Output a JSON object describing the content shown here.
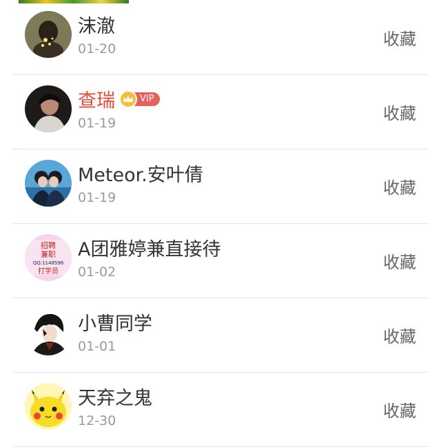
{
  "favorite_label": "收藏",
  "rows": [
    {
      "name": "沫澈",
      "date": "01-20",
      "avatar": "avatar-girl-sparkle"
    },
    {
      "name": "查瑞",
      "date": "01-19",
      "avatar": "avatar-man-portrait",
      "vip": "VIP"
    },
    {
      "name": "Meteor.安叶倩",
      "date": "01-19",
      "avatar": "avatar-couple"
    },
    {
      "name": "A团雅婷兼直接待",
      "date": "01-02",
      "avatar": "avatar-recruit-banner"
    },
    {
      "name": "小曹同学",
      "date": "01-01",
      "avatar": "avatar-anime-boy"
    },
    {
      "name": "天弃之鬼",
      "date": "12-30",
      "avatar": "avatar-pikachu"
    }
  ],
  "avatar_banner_text": [
    "招聘",
    "兼职",
    "QQ:1148596",
    "打字员"
  ],
  "colors": {
    "name": "#333333",
    "vip_name": "#e64a3a",
    "date": "#999999",
    "action": "#666666",
    "divider": "#e6e6e6",
    "vip_badge": "#e6615b"
  }
}
